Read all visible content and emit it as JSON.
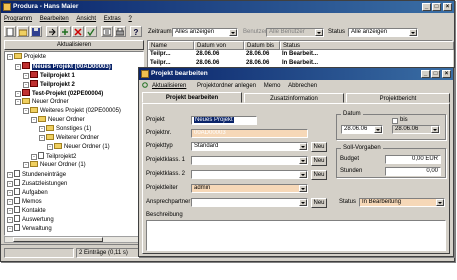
{
  "main": {
    "title": "Produra - Hans Maier",
    "menu": [
      "Programm",
      "Bearbeiten",
      "Ansicht",
      "Extras",
      "?"
    ],
    "filters": {
      "zeitraum_label": "Zeitraum",
      "zeitraum_value": "Alles anzeigen",
      "benutzer_label": "Benutzer",
      "benutzer_value": "Alle Benutzer",
      "status_label": "Status",
      "status_value": "Alle anzeigen"
    },
    "refresh_label": "Aktualisieren",
    "tree": [
      {
        "label": "Projekte",
        "icon": "folder",
        "bold": false,
        "selected": false
      },
      {
        "label": "Neues Projekt (00AD00003)",
        "icon": "project",
        "bold": true,
        "selected": true
      },
      {
        "label": "Teilprojekt 1",
        "icon": "project",
        "bold": true,
        "selected": false
      },
      {
        "label": "Teilprojekt 2",
        "icon": "project",
        "bold": true,
        "selected": false
      },
      {
        "label": "Test-Projekt (02PE00004)",
        "icon": "project",
        "bold": true,
        "selected": false
      },
      {
        "label": "Neuer Ordner",
        "icon": "folder",
        "bold": false,
        "selected": false
      },
      {
        "label": "Weiteres Projekt (02PE00005)",
        "icon": "folder",
        "bold": false,
        "selected": false
      },
      {
        "label": "Neuer Ordner",
        "icon": "folder",
        "bold": false,
        "selected": false
      },
      {
        "label": "Sonstiges (1)",
        "icon": "folder",
        "bold": false,
        "selected": false
      },
      {
        "label": "Weiterer Ordner",
        "icon": "folder",
        "bold": false,
        "selected": false
      },
      {
        "label": "Neuer Ordner (1)",
        "icon": "folder",
        "bold": false,
        "selected": false
      },
      {
        "label": "Teilprojekt2",
        "icon": "doc",
        "bold": false,
        "selected": false
      },
      {
        "label": "Neuer Ordner (1)",
        "icon": "folder",
        "bold": false,
        "selected": false
      },
      {
        "label": "Stundeneinträge",
        "icon": "doc",
        "bold": false,
        "selected": false
      },
      {
        "label": "Zusatzleistungen",
        "icon": "doc",
        "bold": false,
        "selected": false
      },
      {
        "label": "Aufgaben",
        "icon": "doc",
        "bold": false,
        "selected": false
      },
      {
        "label": "Memos",
        "icon": "doc",
        "bold": false,
        "selected": false
      },
      {
        "label": "Kontakte",
        "icon": "doc",
        "bold": false,
        "selected": false
      },
      {
        "label": "Auswertung",
        "icon": "doc",
        "bold": false,
        "selected": false
      },
      {
        "label": "Verwaltung",
        "icon": "doc",
        "bold": false,
        "selected": false
      }
    ],
    "list": {
      "columns": [
        "Name",
        "Datum von",
        "Datum bis",
        "Status"
      ],
      "rows": [
        [
          "Teilpr...",
          "28.06.06",
          "28.06.06",
          "In Bearbeit..."
        ],
        [
          "Teilpr...",
          "28.06.06",
          "28.06.06",
          "In Bearbeit..."
        ]
      ]
    },
    "status": "2 Einträge (0,11 s)"
  },
  "dialog": {
    "title": "Projekt bearbeiten",
    "toolbar": [
      "Aktualisieren",
      "Projektordner anlegen",
      "Memo",
      "Abbrechen"
    ],
    "tabs": [
      "Projekt bearbeiten",
      "Zusatzinformation",
      "Projektbericht"
    ],
    "fields": {
      "projekt_label": "Projekt",
      "projekt_value": "Neues Projekt",
      "projektnr_label": "Projektnr.",
      "projektnr_value": "00AD00003",
      "projekttyp_label": "Projekttyp",
      "projekttyp_value": "Standard",
      "klasse1_label": "Projektklass. 1",
      "klasse1_value": "",
      "klasse2_label": "Projektklass. 2",
      "klasse2_value": "",
      "leiter_label": "Projektleiter",
      "leiter_value": "admin",
      "ansprech_label": "Ansprechpartner",
      "ansprech_value": "",
      "neu_label": "Neu",
      "datum_title": "Datum",
      "datum_von": "28.06.06",
      "bis_label": "bis",
      "datum_bis": "28.06.06",
      "soll_title": "Soll-Vorgaben",
      "budget_label": "Budget",
      "budget_value": "0,00 EUR",
      "stunden_label": "Stunden",
      "stunden_value": "0,00",
      "status_label": "Status",
      "status_value": "In Bearbeitung",
      "beschreibung_label": "Beschreibung"
    }
  }
}
